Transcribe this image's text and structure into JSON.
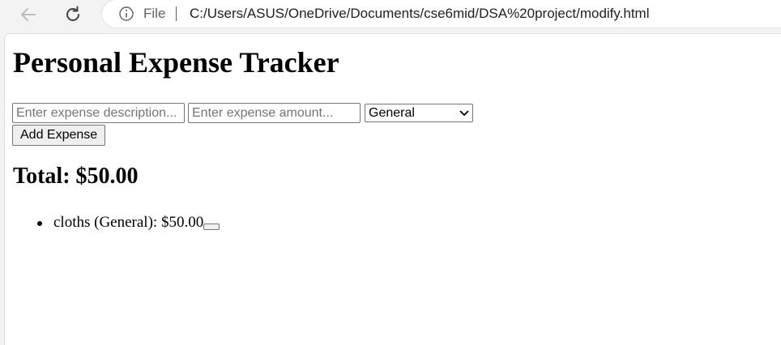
{
  "browser": {
    "back_icon": "arrow-left-icon",
    "reload_icon": "reload-icon",
    "info_icon": "info-icon",
    "file_label": "File",
    "url": "C:/Users/ASUS/OneDrive/Documents/cse6mid/DSA%20project/modify.html"
  },
  "page": {
    "title": "Personal Expense Tracker",
    "form": {
      "description_placeholder": "Enter expense description...",
      "amount_placeholder": "Enter expense amount...",
      "category_selected": "General",
      "add_button_label": "Add Expense"
    },
    "total_text": "Total: $50.00",
    "expenses": [
      {
        "text": "cloths (General): $50.00"
      }
    ]
  }
}
